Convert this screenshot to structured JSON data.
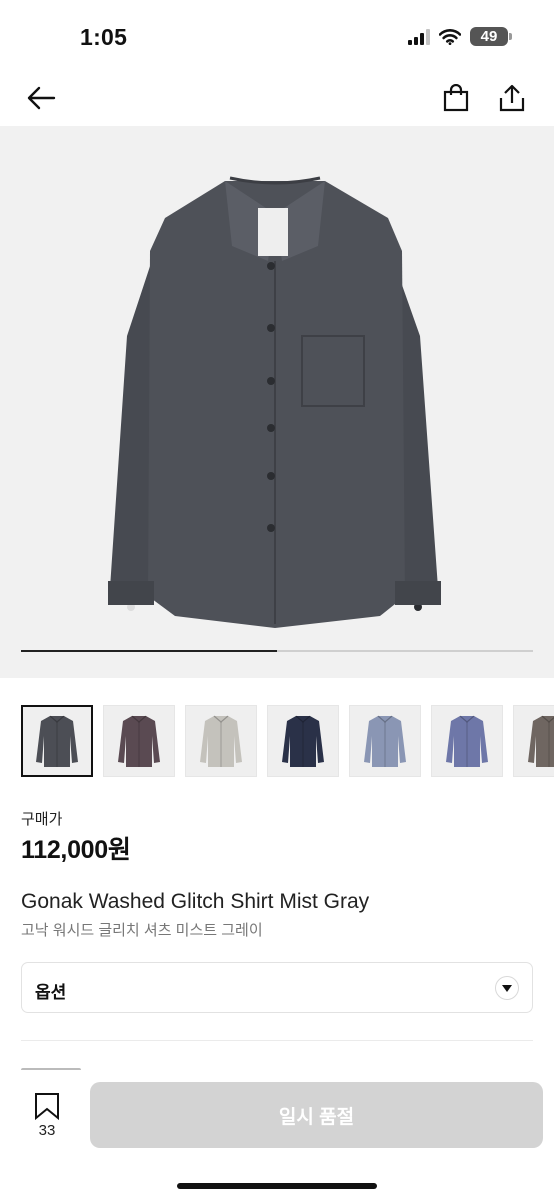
{
  "status_bar": {
    "time": "1:05",
    "battery": "49"
  },
  "nav": {
    "back_icon": "arrow-left-icon",
    "bag_icon": "shopping-bag-icon",
    "share_icon": "share-icon"
  },
  "gallery": {
    "progress_fraction": 0.5,
    "main_color": "#4c4e55",
    "thumbnail_colors": [
      "#4c4e55",
      "#5a4a52",
      "#c4c2bc",
      "#2a3148",
      "#8a96b4",
      "#6e77a8",
      "#6f6661"
    ],
    "selected_index": 0
  },
  "product": {
    "price_label": "구매가",
    "price": "112,000원",
    "name_en": "Gonak Washed Glitch Shirt Mist Gray",
    "name_ko": "고낙 워시드 글리치 셔츠 미스트 그레이"
  },
  "option": {
    "label": "옵션",
    "caret_icon": "chevron-down-icon"
  },
  "bottom_bar": {
    "wish_icon": "bookmark-icon",
    "wish_count": "33",
    "cta_label": "일시 품절",
    "cta_color": "#d3d3d3"
  }
}
